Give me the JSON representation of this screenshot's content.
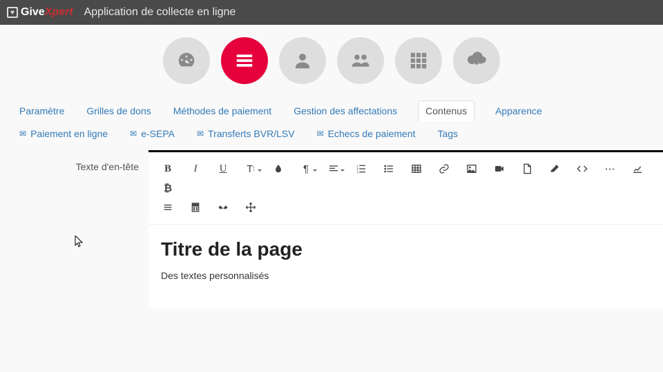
{
  "brand": {
    "name_a": "Give",
    "name_b": "Xpert"
  },
  "app_title": "Application de collecte en ligne",
  "nav": [
    {
      "id": "dashboard",
      "active": false
    },
    {
      "id": "menu",
      "active": true
    },
    {
      "id": "user",
      "active": false
    },
    {
      "id": "group",
      "active": false
    },
    {
      "id": "grid",
      "active": false
    },
    {
      "id": "download",
      "active": false
    }
  ],
  "tabs": [
    {
      "id": "param",
      "label": "Paramètre",
      "active": false,
      "icon": null
    },
    {
      "id": "grilles",
      "label": "Grilles de dons",
      "active": false,
      "icon": null
    },
    {
      "id": "methodes",
      "label": "Méthodes de paiement",
      "active": false,
      "icon": null
    },
    {
      "id": "gestion",
      "label": "Gestion des affectations",
      "active": false,
      "icon": null
    },
    {
      "id": "contenus",
      "label": "Contenus",
      "active": true,
      "icon": null
    },
    {
      "id": "apparence",
      "label": "Apparence",
      "active": false,
      "icon": null
    },
    {
      "id": "paiement",
      "label": "Paiement en ligne",
      "active": false,
      "icon": "envelope"
    },
    {
      "id": "esepa",
      "label": "e-SEPA",
      "active": false,
      "icon": "envelope"
    },
    {
      "id": "bvrlsv",
      "label": "Transferts BVR/LSV",
      "active": false,
      "icon": "envelope"
    },
    {
      "id": "echecs",
      "label": "Echecs de paiement",
      "active": false,
      "icon": "envelope"
    },
    {
      "id": "tags",
      "label": "Tags",
      "active": false,
      "icon": null
    }
  ],
  "field_label": "Texte d'en-tête",
  "editor_content": {
    "title": "Titre de la page",
    "paragraph": "Des textes personnalisés"
  },
  "toolbar_buttons": [
    "bold",
    "italic",
    "underline",
    "font-size",
    "color",
    "paragraph",
    "align",
    "ol",
    "ul",
    "table",
    "link",
    "image",
    "video",
    "file",
    "eraser",
    "code",
    "ellipsis",
    "chart",
    "bitcoin",
    "lines",
    "calc",
    "handshake",
    "move"
  ]
}
